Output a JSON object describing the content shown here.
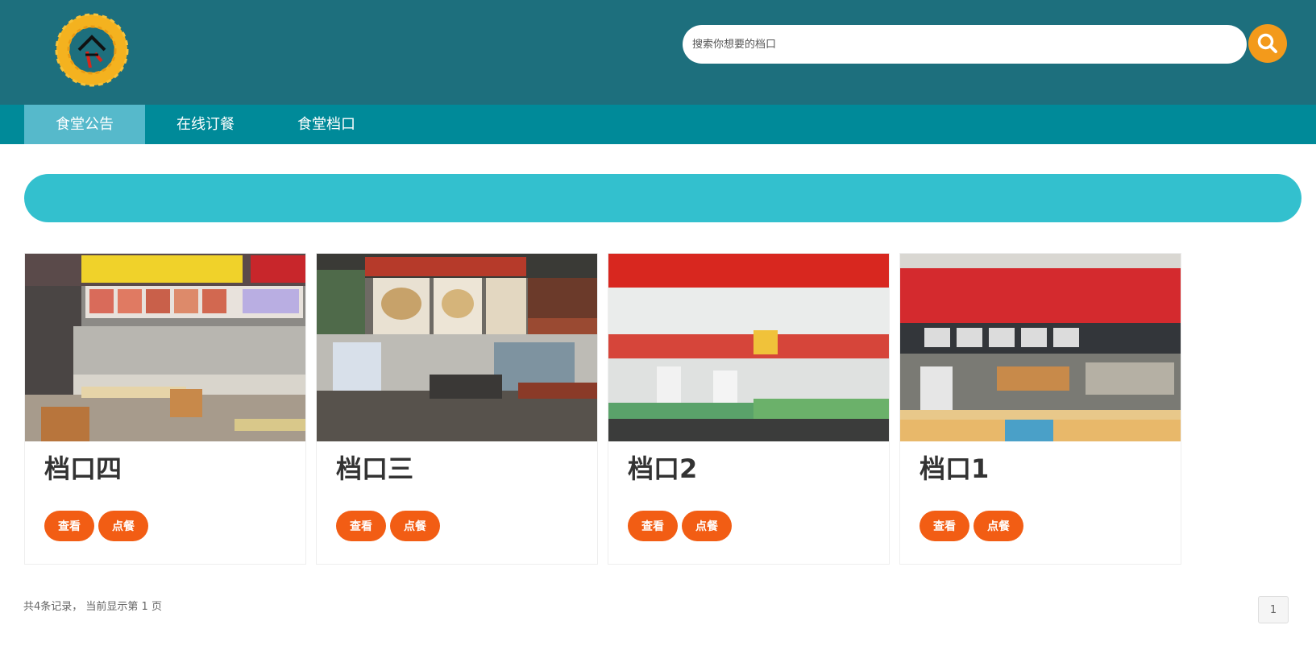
{
  "header": {
    "logo_icon": "rice-wheat-logo-icon",
    "search": {
      "placeholder": "搜索你想要的档口",
      "value": "",
      "button_icon": "search-icon"
    }
  },
  "nav": {
    "items": [
      {
        "label": "食堂公告",
        "active": true
      },
      {
        "label": "在线订餐",
        "active": false
      },
      {
        "label": "食堂档口",
        "active": false
      }
    ]
  },
  "stalls": [
    {
      "name": "档口四",
      "view_label": "查看",
      "order_label": "点餐"
    },
    {
      "name": "档口三",
      "view_label": "查看",
      "order_label": "点餐"
    },
    {
      "name": "档口2",
      "view_label": "查看",
      "order_label": "点餐"
    },
    {
      "name": "档口1",
      "view_label": "查看",
      "order_label": "点餐"
    }
  ],
  "footer": {
    "record_info": "共4条记录， 当前显示第 1 页",
    "current_page": "1"
  },
  "colors": {
    "header_bg": "#1d6f7d",
    "nav_bg": "#008a99",
    "nav_active": "#56b9cb",
    "banner": "#33c0ce",
    "button": "#f25d14",
    "search_button": "#f39a1b"
  }
}
